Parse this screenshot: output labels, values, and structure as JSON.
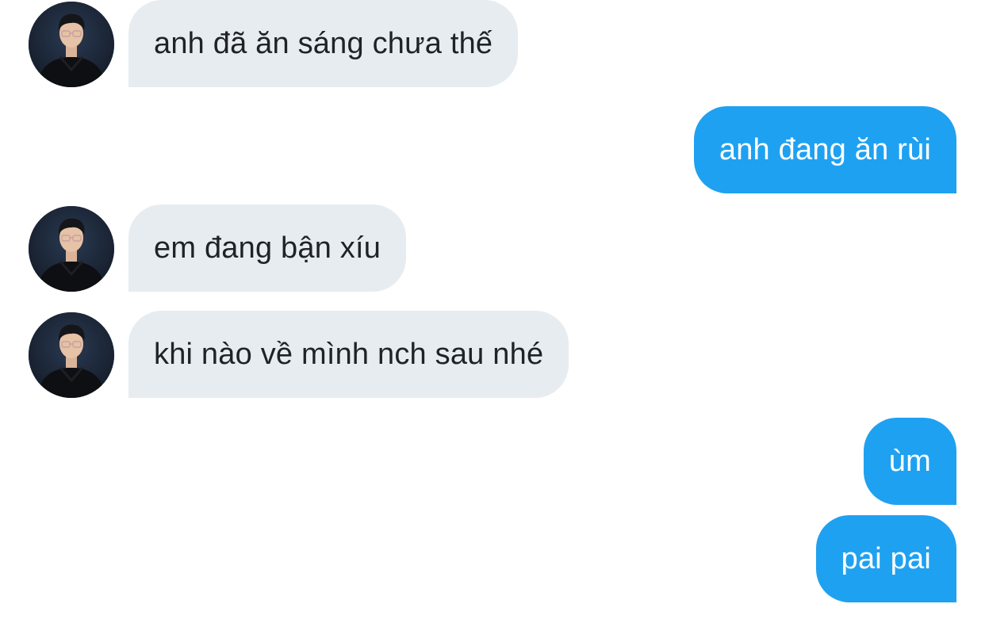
{
  "conversation": {
    "messages": [
      {
        "sender": "them",
        "text": "anh đã ăn sáng chưa thế"
      },
      {
        "sender": "me",
        "text": "anh đang ăn rùi"
      },
      {
        "sender": "them",
        "text": "em đang bận xíu"
      },
      {
        "sender": "them",
        "text": "khi nào về mình nch sau nhé"
      },
      {
        "sender": "me",
        "text": "ùm"
      },
      {
        "sender": "me",
        "text": "pai pai"
      }
    ]
  },
  "colors": {
    "incoming_bubble": "#e7ecf0",
    "outgoing_bubble": "#1fa1f1",
    "incoming_text": "#1f2328",
    "outgoing_text": "#ffffff",
    "background": "#ffffff"
  },
  "icons": {
    "avatar": "contact-avatar-photo"
  }
}
